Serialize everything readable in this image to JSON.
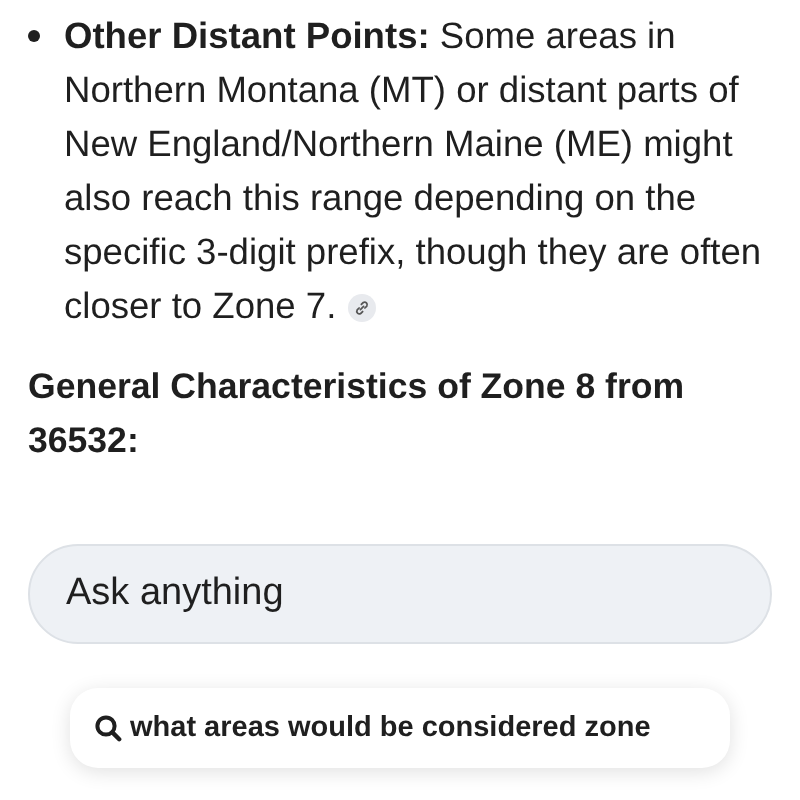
{
  "bullets": [
    {
      "text": "**Other Distant Points:** Some areas in Northern Montana (MT) or distant parts of New England/Northern Maine (ME) might also reach this range depending on the specific 3-digit prefix, though they are often closer to Zone 7.",
      "has_source_link": true
    }
  ],
  "heading": "General Characteristics of Zone 8 from 36532:",
  "composer": {
    "placeholder": "Ask anything"
  },
  "suggestion": {
    "text": "what areas would be considered zone"
  }
}
